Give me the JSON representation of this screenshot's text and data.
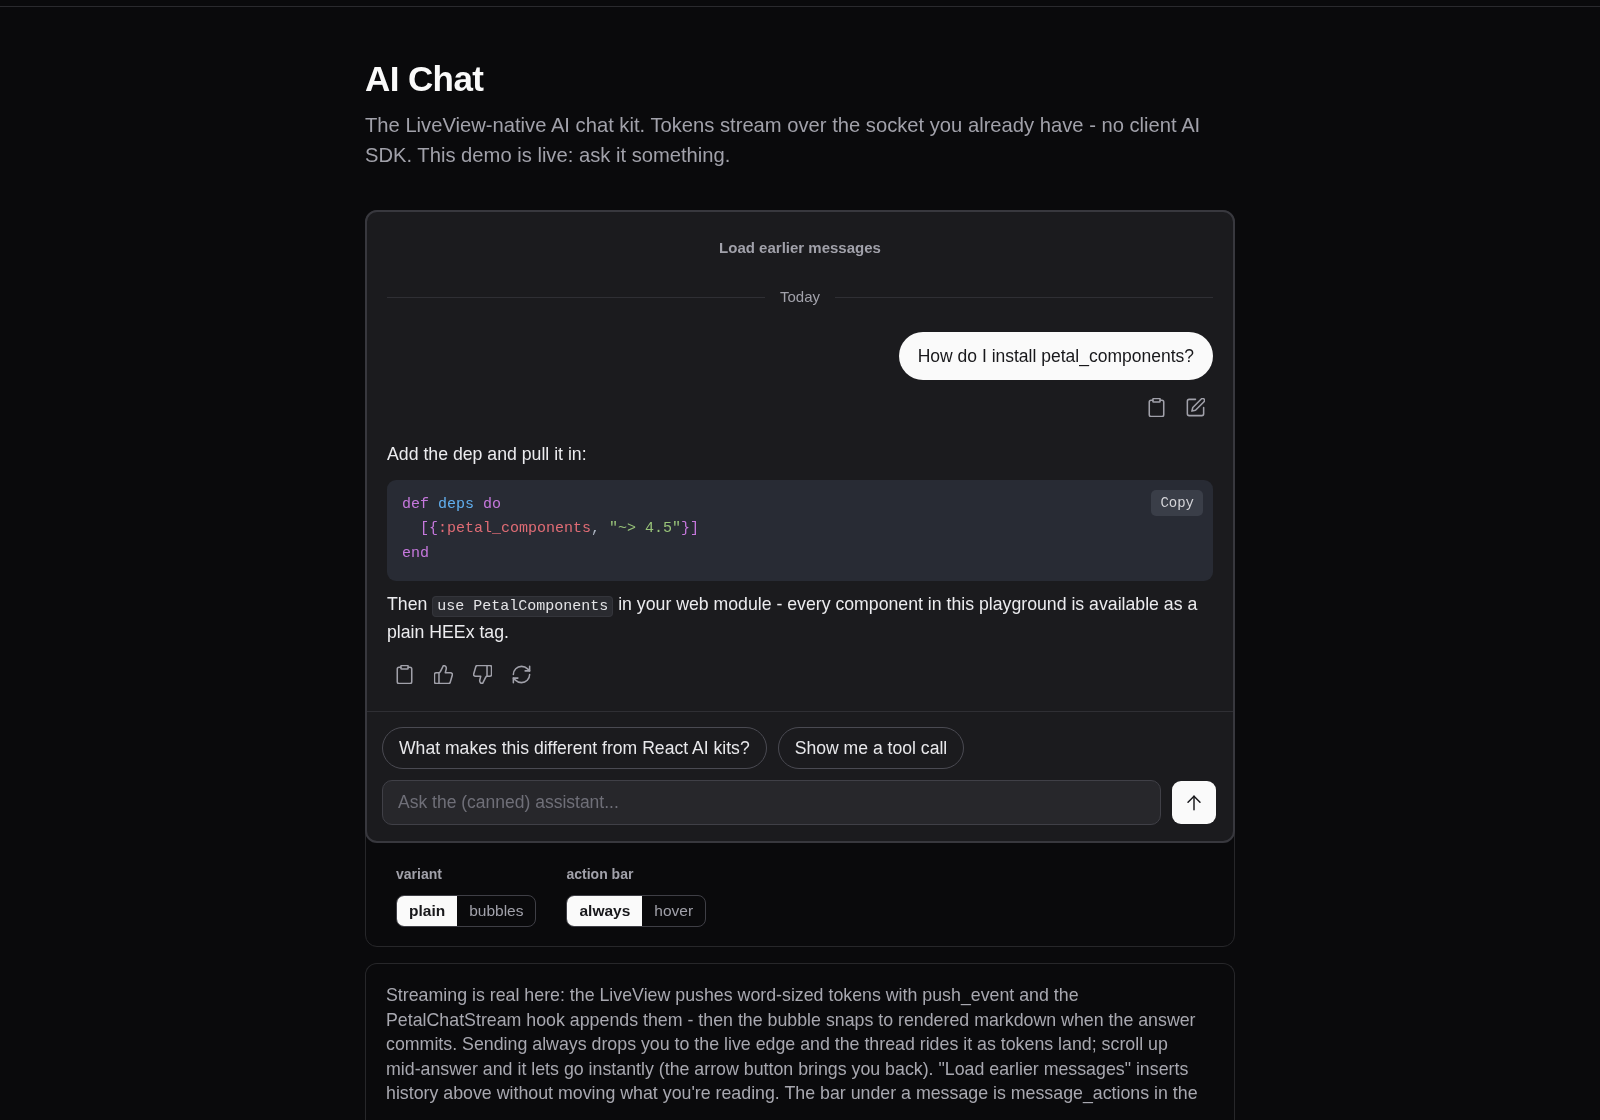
{
  "page": {
    "title": "AI Chat",
    "description": "The LiveView-native AI chat kit. Tokens stream over the socket you already have - no client AI SDK. This demo is live: ask it something."
  },
  "chat": {
    "load_earlier": "Load earlier messages",
    "date_divider": "Today",
    "messages": [
      {
        "kind": "user",
        "text": "How do I install petal_components?"
      },
      {
        "kind": "assistant",
        "blocks": [
          {
            "kind": "paragraph",
            "segments": [
              {
                "kind": "text",
                "text": "Add the dep and pull it in:"
              }
            ]
          },
          {
            "kind": "code",
            "copy_label": "Copy",
            "lines": [
              {
                "tokens": [
                  {
                    "kind": "keyword",
                    "text": "def"
                  },
                  {
                    "kind": "function",
                    "text": " deps"
                  },
                  {
                    "kind": "keyword",
                    "text": " do"
                  }
                ]
              },
              {
                "tokens": [
                  {
                    "kind": "punctuation",
                    "text": "  [{"
                  },
                  {
                    "kind": "atom",
                    "text": ":petal_components"
                  },
                  {
                    "kind": "plain",
                    "text": ", "
                  },
                  {
                    "kind": "string",
                    "text": "\"~> 4.5\""
                  },
                  {
                    "kind": "punctuation",
                    "text": "}]"
                  }
                ]
              },
              {
                "tokens": [
                  {
                    "kind": "keyword",
                    "text": "end"
                  }
                ]
              }
            ]
          },
          {
            "kind": "paragraph",
            "segments": [
              {
                "kind": "text",
                "text": "Then "
              },
              {
                "kind": "code",
                "text": "use PetalComponents"
              },
              {
                "kind": "text",
                "text": " in your web module - every component in this playground is available as a plain HEEx tag."
              }
            ]
          }
        ]
      }
    ],
    "suggestions": [
      "What makes this different from React AI kits?",
      "Show me a tool call"
    ],
    "composer": {
      "placeholder": "Ask the (canned) assistant..."
    }
  },
  "controls": [
    {
      "label": "variant",
      "options": [
        {
          "label": "plain",
          "selected": true
        },
        {
          "label": "bubbles",
          "selected": false
        }
      ]
    },
    {
      "label": "action bar",
      "options": [
        {
          "label": "always",
          "selected": true
        },
        {
          "label": "hover",
          "selected": false
        }
      ]
    }
  ],
  "note": "Streaming is real here: the LiveView pushes word-sized tokens with push_event and the PetalChatStream hook appends them - then the bubble snaps to rendered markdown when the answer commits. Sending always drops you to the live edge and the thread rides it as tokens land; scroll up mid-answer and it lets go instantly (the arrow button brings you back). \"Load earlier messages\" inserts history above without moving what you're reading. The bar under a message is message_actions in the"
}
